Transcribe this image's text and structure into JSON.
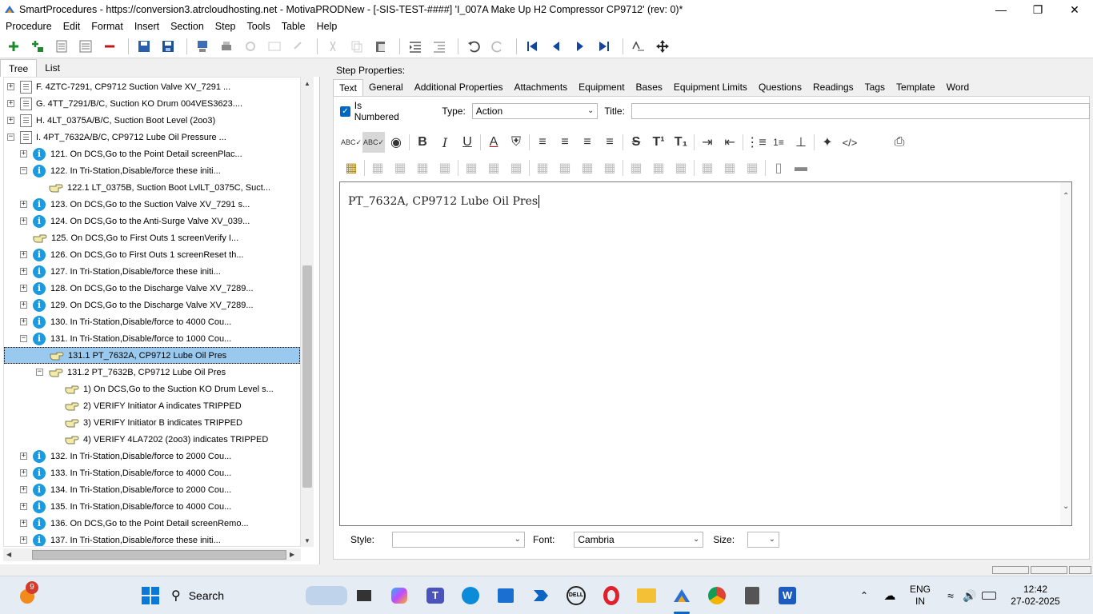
{
  "window": {
    "title": "SmartProcedures - https://conversion3.atrcloudhosting.net - MotivaPRODNew - [-SIS-TEST-####] 'I_007A Make Up H2 Compressor CP9712' (rev: 0)*",
    "minimize": "—",
    "restore": "❐",
    "close": "✕"
  },
  "menu": [
    "Procedure",
    "Edit",
    "Format",
    "Insert",
    "Section",
    "Step",
    "Tools",
    "Table",
    "Help"
  ],
  "left_tabs": [
    "Tree",
    "List"
  ],
  "tree": [
    {
      "text": "F. 4ZTC-7291, CP9712 Suction Valve XV_7291 ...",
      "icon": "section",
      "exp": "+",
      "indent": 0
    },
    {
      "text": "G. 4TT_7291/B/C, Suction KO Drum 004VES3623....",
      "icon": "section",
      "exp": "+",
      "indent": 0
    },
    {
      "text": "H. 4LT_0375A/B/C, Suction Boot Level (2oo3)",
      "icon": "section",
      "exp": "+",
      "indent": 0
    },
    {
      "text": "I. 4PT_7632A/B/C, CP9712 Lube Oil Pressure ...",
      "icon": "section",
      "exp": "−",
      "indent": 0
    },
    {
      "text": "121. On DCS,Go to the Point Detail screenPlac...",
      "icon": "info",
      "exp": "+",
      "indent": 1
    },
    {
      "text": "122. In Tri-Station,Disable/force these initi...",
      "icon": "info",
      "exp": "−",
      "indent": 1
    },
    {
      "text": "122.1 LT_0375B, Suction Boot LvlLT_0375C, Suct...",
      "icon": "hand",
      "exp": "",
      "indent": 2
    },
    {
      "text": "123. On DCS,Go to the Suction Valve XV_7291 s...",
      "icon": "info",
      "exp": "+",
      "indent": 1
    },
    {
      "text": "124. On DCS,Go to the Anti-Surge Valve XV_039...",
      "icon": "info",
      "exp": "+",
      "indent": 1
    },
    {
      "text": "125. On DCS,Go to First Outs 1 screenVerify I...",
      "icon": "hand",
      "exp": "",
      "indent": 1
    },
    {
      "text": "126. On DCS,Go to First Outs 1 screenReset th...",
      "icon": "info",
      "exp": "+",
      "indent": 1
    },
    {
      "text": "127. In Tri-Station,Disable/force these initi...",
      "icon": "info",
      "exp": "+",
      "indent": 1
    },
    {
      "text": "128. On DCS,Go to the Discharge Valve XV_7289...",
      "icon": "info",
      "exp": "+",
      "indent": 1
    },
    {
      "text": "129. On DCS,Go to the Discharge Valve XV_7289...",
      "icon": "info",
      "exp": "+",
      "indent": 1
    },
    {
      "text": "130. In Tri-Station,Disable/force to 4000 Cou...",
      "icon": "info",
      "exp": "+",
      "indent": 1
    },
    {
      "text": "131. In Tri-Station,Disable/force to 1000 Cou...",
      "icon": "info",
      "exp": "−",
      "indent": 1
    },
    {
      "text": "131.1 PT_7632A, CP9712 Lube Oil Pres",
      "icon": "hand",
      "exp": "",
      "indent": 2,
      "selected": true
    },
    {
      "text": "131.2 PT_7632B, CP9712 Lube Oil Pres",
      "icon": "hand",
      "exp": "−",
      "indent": 2
    },
    {
      "text": "1) On DCS,Go to the Suction KO Drum Level s...",
      "icon": "hand",
      "exp": "",
      "indent": 3
    },
    {
      "text": "2) VERIFY Initiator A indicates TRIPPED",
      "icon": "hand",
      "exp": "",
      "indent": 3
    },
    {
      "text": "3) VERIFY Initiator B indicates TRIPPED",
      "icon": "hand",
      "exp": "",
      "indent": 3
    },
    {
      "text": "4) VERIFY 4LA7202 (2oo3) indicates TRIPPED",
      "icon": "hand",
      "exp": "",
      "indent": 3
    },
    {
      "text": "132. In Tri-Station,Disable/force to 2000 Cou...",
      "icon": "info",
      "exp": "+",
      "indent": 1
    },
    {
      "text": "133. In Tri-Station,Disable/force to 4000 Cou...",
      "icon": "info",
      "exp": "+",
      "indent": 1
    },
    {
      "text": "134. In Tri-Station,Disable/force to 2000 Cou...",
      "icon": "info",
      "exp": "+",
      "indent": 1
    },
    {
      "text": "135. In Tri-Station,Disable/force to 4000 Cou...",
      "icon": "info",
      "exp": "+",
      "indent": 1
    },
    {
      "text": "136. On DCS,Go to the Point Detail screenRemo...",
      "icon": "info",
      "exp": "+",
      "indent": 1
    },
    {
      "text": "137. In Tri-Station,Disable/force these initi...",
      "icon": "info",
      "exp": "+",
      "indent": 1
    }
  ],
  "step_properties": {
    "label": "Step Properties:",
    "tabs": [
      "Text",
      "General",
      "Additional Properties",
      "Attachments",
      "Equipment",
      "Bases",
      "Equipment Limits",
      "Questions",
      "Readings",
      "Tags",
      "Template",
      "Word"
    ],
    "is_numbered_label": "Is Numbered",
    "is_numbered": true,
    "type_label": "Type:",
    "type_value": "Action",
    "title_label": "Title:",
    "title_value": "",
    "editor_text": "PT_7632A, CP9712 Lube Oil Pres",
    "style_label": "Style:",
    "style_value": "",
    "font_label": "Font:",
    "font_value": "Cambria",
    "size_label": "Size:",
    "size_value": ""
  },
  "format_toolbar": {
    "bold": "B",
    "italic": "I",
    "underline": "U",
    "font_color": "A",
    "strike": "S",
    "superscript": "T¹",
    "subscript": "T₁",
    "code": "</>"
  },
  "taskbar": {
    "notification_badge": "9",
    "search_label": "Search",
    "language": "ENG",
    "region": "IN",
    "time": "12:42",
    "date": "27-02-2025"
  }
}
